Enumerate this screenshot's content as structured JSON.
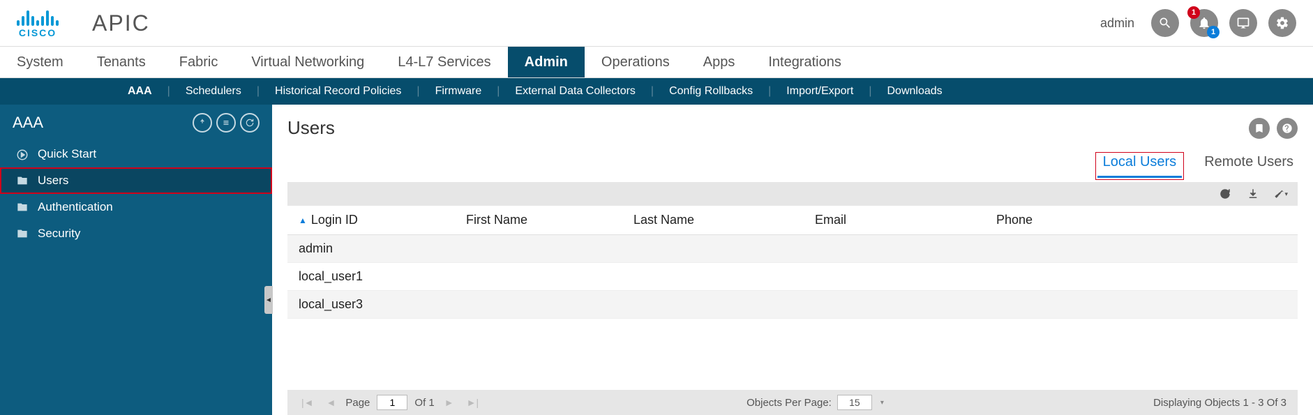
{
  "brand": {
    "name": "CISCO",
    "app": "APIC"
  },
  "header": {
    "user": "admin",
    "notif_red": "1",
    "notif_blue": "1"
  },
  "mainNav": [
    "System",
    "Tenants",
    "Fabric",
    "Virtual Networking",
    "L4-L7 Services",
    "Admin",
    "Operations",
    "Apps",
    "Integrations"
  ],
  "mainNavActive": "Admin",
  "subNav": [
    "AAA",
    "Schedulers",
    "Historical Record Policies",
    "Firmware",
    "External Data Collectors",
    "Config Rollbacks",
    "Import/Export",
    "Downloads"
  ],
  "subNavActive": "AAA",
  "sidebar": {
    "title": "AAA",
    "items": [
      "Quick Start",
      "Users",
      "Authentication",
      "Security"
    ],
    "selected": "Users"
  },
  "content": {
    "title": "Users",
    "tabs": [
      "Local Users",
      "Remote Users"
    ],
    "activeTab": "Local Users",
    "columns": [
      "Login ID",
      "First Name",
      "Last Name",
      "Email",
      "Phone"
    ],
    "rows": [
      {
        "login": "admin",
        "first": "",
        "last": "",
        "email": "",
        "phone": ""
      },
      {
        "login": "local_user1",
        "first": "",
        "last": "",
        "email": "",
        "phone": ""
      },
      {
        "login": "local_user3",
        "first": "",
        "last": "",
        "email": "",
        "phone": ""
      }
    ],
    "footer": {
      "pageLabel": "Page",
      "page": "1",
      "ofLabel": "Of 1",
      "oppLabel": "Objects Per Page:",
      "opp": "15",
      "display": "Displaying Objects 1 - 3 Of 3"
    }
  }
}
